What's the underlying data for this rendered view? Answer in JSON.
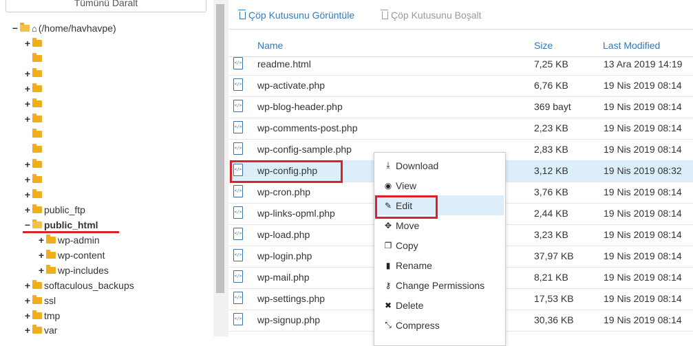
{
  "tree": {
    "collapse_label": "Tümünü Daralt",
    "root_label": "(/home/havhavpe)",
    "items": [
      {
        "label": ""
      },
      {
        "label": ""
      },
      {
        "label": ""
      },
      {
        "label": ""
      },
      {
        "label": ""
      },
      {
        "label": ""
      },
      {
        "label": ""
      },
      {
        "label": ""
      },
      {
        "label": ""
      },
      {
        "label": ""
      },
      {
        "label": ""
      },
      {
        "label": "public_ftp"
      },
      {
        "label": "public_html"
      },
      {
        "label": "wp-admin"
      },
      {
        "label": "wp-content"
      },
      {
        "label": "wp-includes"
      },
      {
        "label": "softaculous_backups"
      },
      {
        "label": "ssl"
      },
      {
        "label": "tmp"
      },
      {
        "label": "var"
      }
    ]
  },
  "toolbar": {
    "view_trash": "Çöp Kutusunu Görüntüle",
    "empty_trash": "Çöp Kutusunu Boşalt"
  },
  "table": {
    "headers": {
      "name": "Name",
      "size": "Size",
      "modified": "Last Modified"
    },
    "rows": [
      {
        "name": "readme.html",
        "size": "7,25 KB",
        "modified": "13 Ara 2019 14:19"
      },
      {
        "name": "wp-activate.php",
        "size": "6,76 KB",
        "modified": "19 Nis 2019 08:14"
      },
      {
        "name": "wp-blog-header.php",
        "size": "369 bayt",
        "modified": "19 Nis 2019 08:14"
      },
      {
        "name": "wp-comments-post.php",
        "size": "2,23 KB",
        "modified": "19 Nis 2019 08:14"
      },
      {
        "name": "wp-config-sample.php",
        "size": "2,83 KB",
        "modified": "19 Nis 2019 08:14"
      },
      {
        "name": "wp-config.php",
        "size": "3,12 KB",
        "modified": "19 Nis 2019 08:32"
      },
      {
        "name": "wp-cron.php",
        "size": "3,76 KB",
        "modified": "19 Nis 2019 08:14"
      },
      {
        "name": "wp-links-opml.php",
        "size": "2,44 KB",
        "modified": "19 Nis 2019 08:14"
      },
      {
        "name": "wp-load.php",
        "size": "3,23 KB",
        "modified": "19 Nis 2019 08:14"
      },
      {
        "name": "wp-login.php",
        "size": "37,97 KB",
        "modified": "19 Nis 2019 08:14"
      },
      {
        "name": "wp-mail.php",
        "size": "8,21 KB",
        "modified": "19 Nis 2019 08:14"
      },
      {
        "name": "wp-settings.php",
        "size": "17,53 KB",
        "modified": "19 Nis 2019 08:14"
      },
      {
        "name": "wp-signup.php",
        "size": "30,36 KB",
        "modified": "19 Nis 2019 08:14"
      }
    ]
  },
  "context_menu": {
    "items": [
      {
        "label": "Download",
        "icon": "download-icon",
        "glyph": "⤓"
      },
      {
        "label": "View",
        "icon": "eye-icon",
        "glyph": "◉"
      },
      {
        "label": "Edit",
        "icon": "pencil-icon",
        "glyph": "✎"
      },
      {
        "label": "Move",
        "icon": "move-icon",
        "glyph": "✥"
      },
      {
        "label": "Copy",
        "icon": "copy-icon",
        "glyph": "❐"
      },
      {
        "label": "Rename",
        "icon": "file-icon",
        "glyph": "▮"
      },
      {
        "label": "Change Permissions",
        "icon": "key-icon",
        "glyph": "⚷"
      },
      {
        "label": "Delete",
        "icon": "close-icon",
        "glyph": "✖"
      },
      {
        "label": "Compress",
        "icon": "compress-icon",
        "glyph": "⤡"
      }
    ]
  },
  "colors": {
    "accent": "#337ab7",
    "highlight": "#d9232a",
    "selected_row": "#ddeefb",
    "folder": "#f0ad1e"
  }
}
